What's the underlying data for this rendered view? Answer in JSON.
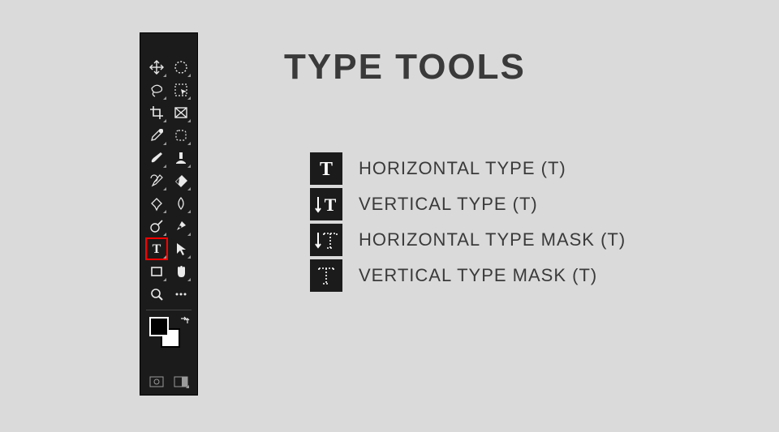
{
  "title": "TYPE TOOLS",
  "tools": [
    {
      "label": "HORIZONTAL TYPE (T)"
    },
    {
      "label": "VERTICAL TYPE (T)"
    },
    {
      "label": "HORIZONTAL TYPE MASK (T)"
    },
    {
      "label": "VERTICAL TYPE MASK (T)"
    }
  ],
  "toolbar": {
    "items": [
      "move",
      "marquee",
      "lasso",
      "quick-select",
      "crop",
      "slice",
      "eyedropper",
      "spot-heal",
      "brush",
      "clone",
      "history-brush",
      "eraser",
      "gradient",
      "blur",
      "dodge",
      "pen",
      "type",
      "path-select",
      "rectangle",
      "hand",
      "zoom",
      "more"
    ]
  }
}
